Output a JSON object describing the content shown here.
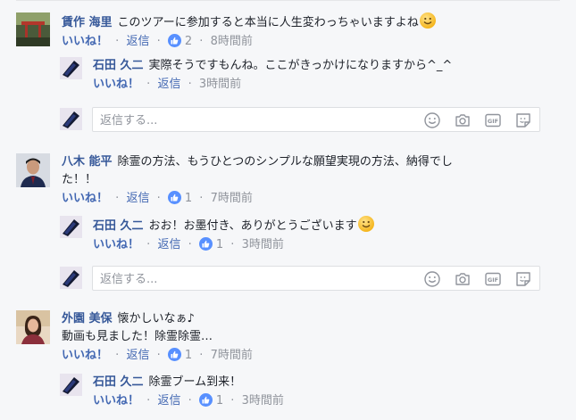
{
  "labels": {
    "like": "いいね！",
    "reply": "返信",
    "separator": "·"
  },
  "reply_box": {
    "placeholder": "返信する..."
  },
  "threads": [
    {
      "comment": {
        "author": "賃作 海里",
        "text": "このツアーに参加すると本当に人生変わっちゃいますよね",
        "text2": "",
        "likes": "2",
        "time": "8時間前"
      },
      "reply": {
        "author": "石田 久二",
        "text": "実際そうですもんね。ここがきっかけになりますから^_^",
        "likes": "",
        "time": "3時間前"
      }
    },
    {
      "comment": {
        "author": "八木 能平",
        "text": "除霊の方法、もうひとつのシンプルな願望実現の方法、納得でし",
        "text2": "た！！",
        "likes": "1",
        "time": "7時間前"
      },
      "reply": {
        "author": "石田 久二",
        "text": "おお！お墨付き、ありがとうございます",
        "likes": "1",
        "time": "3時間前"
      }
    },
    {
      "comment": {
        "author": "外園 美保",
        "text": "懐かしいなぁ♪",
        "text2": "動画も見ました！除霊除霊…",
        "likes": "1",
        "time": "7時間前"
      },
      "reply": {
        "author": "石田 久二",
        "text": "除霊ブーム到来！",
        "likes": "1",
        "time": "3時間前"
      }
    }
  ]
}
